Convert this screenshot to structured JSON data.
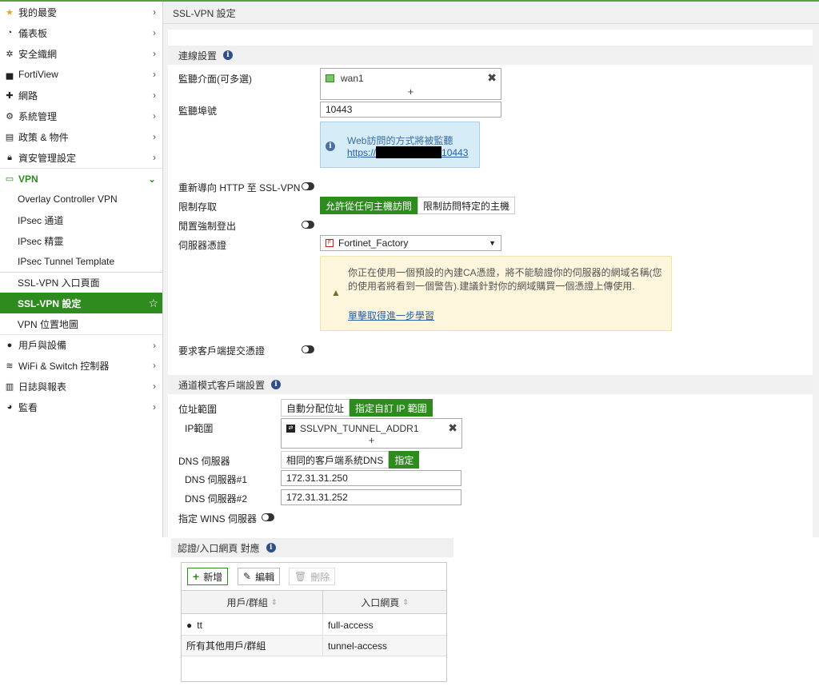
{
  "sidebar": {
    "items": [
      {
        "label": "我的最愛",
        "icon": "star-icon"
      },
      {
        "label": "儀表板",
        "icon": "dashboard-icon"
      },
      {
        "label": "安全織網",
        "icon": "fabric-icon"
      },
      {
        "label": "FortiView",
        "icon": "chart-icon"
      },
      {
        "label": "網路",
        "icon": "network-icon"
      },
      {
        "label": "系統管理",
        "icon": "gear-icon"
      },
      {
        "label": "政策 & 物件",
        "icon": "policy-icon"
      },
      {
        "label": "資安管理設定",
        "icon": "lock-icon"
      },
      {
        "label": "VPN",
        "icon": "laptop-icon"
      }
    ],
    "vpn_sub": [
      "Overlay Controller VPN",
      "IPsec 通道",
      "IPsec 精靈",
      "IPsec Tunnel Template",
      "SSL-VPN 入口頁面",
      "SSL-VPN 設定",
      "VPN 位置地圖"
    ],
    "items_after": [
      {
        "label": "用戶與設備",
        "icon": "user-icon"
      },
      {
        "label": "WiFi & Switch 控制器",
        "icon": "wifi-icon"
      },
      {
        "label": "日誌與報表",
        "icon": "bar-chart-icon"
      },
      {
        "label": "監看",
        "icon": "pie-chart-icon"
      }
    ]
  },
  "header": {
    "title": "SSL-VPN 設定"
  },
  "connection": {
    "section_title": "連線設置",
    "listen_interface_label": "監聽介面(可多選)",
    "listen_interface_value": "wan1",
    "listen_port_label": "監聽埠號",
    "listen_port_value": "10443",
    "web_access_note": "Web訪問的方式將被監聽",
    "web_access_url_prefix": "https://",
    "web_access_url_suffix": "10443",
    "redirect_label": "重新導向 HTTP 至 SSL-VPN",
    "restrict_access_label": "限制存取",
    "restrict_option_any": "允許從任何主機訪問",
    "restrict_option_specific": "限制訪問特定的主機",
    "idle_logout_label": "閒置強制登出",
    "server_cert_label": "伺服器憑證",
    "server_cert_value": "Fortinet_Factory",
    "cert_warning": "你正在使用一個預設的內建CA憑證，將不能驗證你的伺服器的網域名稱(您的使用者將看到一個警告).建議針對你的網域購買一個憑證上傳使用.",
    "cert_warning_link": "單擊取得進一步學習",
    "require_client_cert_label": "要求客戶端提交憑證"
  },
  "tunnel": {
    "section_title": "通道模式客戶端設置",
    "address_range_label": "位址範圍",
    "address_option_auto": "自動分配位址",
    "address_option_custom": "指定自訂 IP 範圍",
    "ip_range_label": "IP範圍",
    "ip_range_value": "SSLVPN_TUNNEL_ADDR1",
    "dns_server_label": "DNS 伺服器",
    "dns_option_same": "相同的客戶端系統DNS",
    "dns_option_specify": "指定",
    "dns1_label": "DNS 伺服器#1",
    "dns1_value": "172.31.31.250",
    "dns2_label": "DNS 伺服器#2",
    "dns2_value": "172.31.31.252",
    "wins_label": "指定 WINS 伺服器"
  },
  "auth_mapping": {
    "section_title": "認證/入口網頁 對應",
    "btn_new": "新增",
    "btn_edit": "編輯",
    "btn_delete": "刪除",
    "columns": [
      "用戶/群組",
      "入口網頁"
    ],
    "rows": [
      {
        "user": "tt",
        "portal": "full-access"
      },
      {
        "user": "所有其他用戶/群組",
        "portal": "tunnel-access"
      }
    ]
  },
  "colors": {
    "accent": "#2e8b1d",
    "info_bg": "#d6ecf7",
    "warn_bg": "#fdf6dc"
  }
}
